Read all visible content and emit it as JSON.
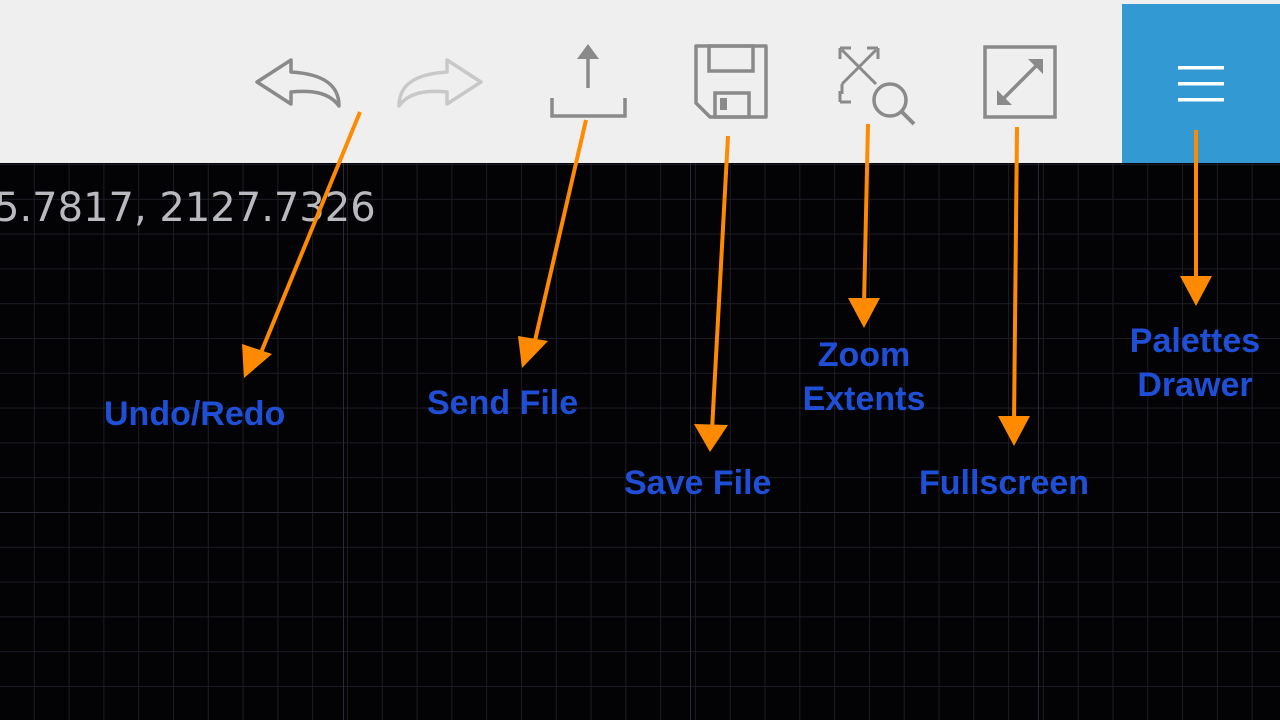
{
  "toolbar": {
    "colors": {
      "background": "#efefef",
      "icon": "#8a8a8a",
      "icon_disabled": "#c8c8c8",
      "menu_bg": "#3399d3"
    },
    "buttons": [
      {
        "id": "undo",
        "icon": "undo-icon",
        "enabled": true
      },
      {
        "id": "redo",
        "icon": "redo-icon",
        "enabled": false
      },
      {
        "id": "send",
        "icon": "share-upload-icon",
        "enabled": true
      },
      {
        "id": "save",
        "icon": "floppy-disk-icon",
        "enabled": true
      },
      {
        "id": "zoom_extents",
        "icon": "zoom-extents-icon",
        "enabled": true
      },
      {
        "id": "fullscreen",
        "icon": "fullscreen-icon",
        "enabled": true
      },
      {
        "id": "palettes",
        "icon": "hamburger-menu-icon",
        "enabled": true
      }
    ]
  },
  "canvas": {
    "background": "#030305",
    "coordinate_readout": "5.7817, 2127.7326"
  },
  "annotations": {
    "arrow_color": "#ff8a00",
    "label_color": "#1f4fd6",
    "undo_redo": "Undo/Redo",
    "send_file": "Send File",
    "save_file": "Save File",
    "zoom_line1": "Zoom",
    "zoom_line2": "Extents",
    "fullscreen": "Fullscreen",
    "palettes_line1": "Palettes",
    "palettes_line2": "Drawer"
  }
}
